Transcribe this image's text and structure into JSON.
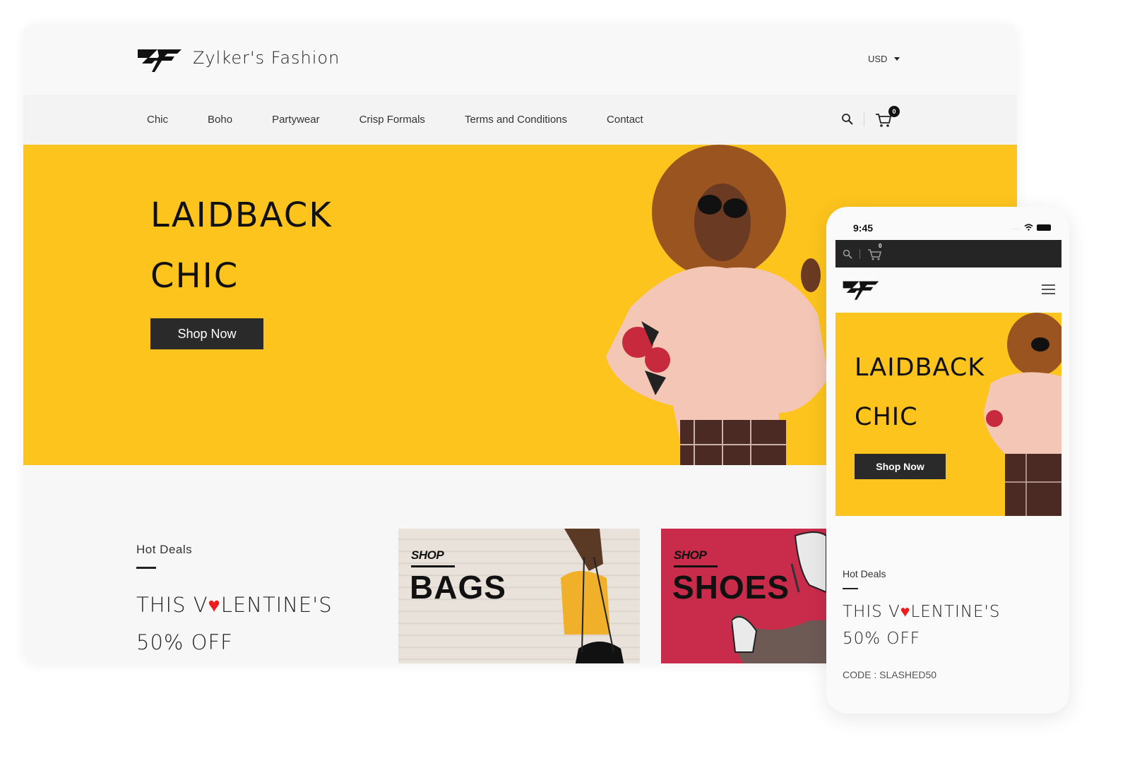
{
  "desktop": {
    "brand_name": "Zylker's Fashion",
    "logo_icon": "zf-logo-icon",
    "currency": "USD",
    "nav": [
      {
        "label": "Chic"
      },
      {
        "label": "Boho"
      },
      {
        "label": "Partywear"
      },
      {
        "label": "Crisp Formals"
      },
      {
        "label": "Terms and Conditions"
      },
      {
        "label": "Contact"
      }
    ],
    "search_icon": "search-icon",
    "cart_icon": "cart-icon",
    "cart_count": "0",
    "hero": {
      "line1": "LAIDBACK",
      "line2": "CHIC",
      "button": "Shop Now",
      "background_color": "#fdc41d"
    },
    "deals": {
      "label": "Hot Deals",
      "headline_pre": "THIS V",
      "heart": "♥",
      "headline_post": "LENTINE'S",
      "offer": "50% OFF"
    },
    "cards": [
      {
        "shop": "SHOP",
        "title": "BAGS"
      },
      {
        "shop": "SHOP",
        "title": "SHOES",
        "color": "#c82c4a"
      }
    ]
  },
  "mobile": {
    "time": "9:45",
    "cart_count": "0",
    "hero": {
      "line1": "LAIDBACK",
      "line2": "CHIC",
      "button": "Shop Now"
    },
    "deals": {
      "label": "Hot Deals",
      "headline_pre": "THIS V",
      "heart": "♥",
      "headline_post": "LENTINE'S",
      "offer": "50% OFF",
      "code": "CODE : SLASHED50"
    }
  }
}
